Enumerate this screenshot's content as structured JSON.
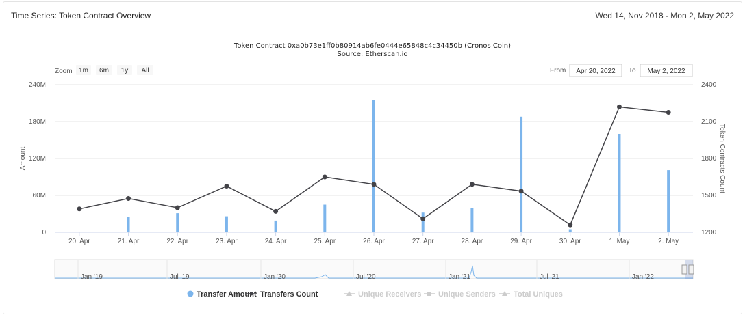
{
  "header": {
    "title": "Time Series: Token Contract Overview",
    "date_range": "Wed 14, Nov 2018 - Mon 2, May 2022"
  },
  "range_selector": {
    "zoom_label": "Zoom",
    "buttons": [
      "1m",
      "6m",
      "1y",
      "All"
    ],
    "from_label": "From",
    "from_value": "Apr 20, 2022",
    "to_label": "To",
    "to_value": "May 2, 2022"
  },
  "navigator": {
    "labels": [
      "Jan '19",
      "Jul '19",
      "Jan '20",
      "Jul '20",
      "Jan '21",
      "Jul '21",
      "Jan '22"
    ]
  },
  "colors": {
    "bar": "#7cb5ec",
    "line": "#434348",
    "grid": "#e6e6e6",
    "legend_inactive": "#cccccc"
  },
  "chart_data": {
    "type": "bar",
    "title": "Token Contract 0xa0b73e1ff0b80914ab6fe0444e65848c4c34450b (Cronos Coin)",
    "subtitle": "Source: Etherscan.io",
    "categories": [
      "20. Apr",
      "21. Apr",
      "22. Apr",
      "23. Apr",
      "24. Apr",
      "25. Apr",
      "26. Apr",
      "27. Apr",
      "28. Apr",
      "29. Apr",
      "30. Apr",
      "1. May",
      "2. May"
    ],
    "ylabel_left": "Amount",
    "ylabel_right": "Token Contracts Count",
    "yticks_left": [
      "0",
      "60M",
      "120M",
      "180M",
      "240M"
    ],
    "yticks_right": [
      "1200",
      "1500",
      "1800",
      "2100",
      "2400"
    ],
    "ylim_left": [
      0,
      240
    ],
    "ylim_right": [
      1200,
      2400
    ],
    "grid": true,
    "legend_placement": "bottom-center",
    "series": [
      {
        "name": "Transfer Amount",
        "kind": "bar",
        "axis": "left",
        "unit": "M",
        "values": [
          0,
          25,
          31,
          26,
          19,
          45,
          215,
          32,
          40,
          188,
          5,
          160,
          101
        ]
      },
      {
        "name": "Transfers Count",
        "kind": "line",
        "axis": "right",
        "values": [
          1390,
          1475,
          1400,
          1575,
          1370,
          1650,
          1590,
          1310,
          1590,
          1535,
          1260,
          2220,
          2175
        ]
      }
    ],
    "legend": [
      {
        "name": "Transfer Amount",
        "active": true
      },
      {
        "name": "Transfers Count",
        "active": true
      },
      {
        "name": "Unique Receivers",
        "active": false
      },
      {
        "name": "Unique Senders",
        "active": false
      },
      {
        "name": "Total Uniques",
        "active": false
      }
    ]
  }
}
